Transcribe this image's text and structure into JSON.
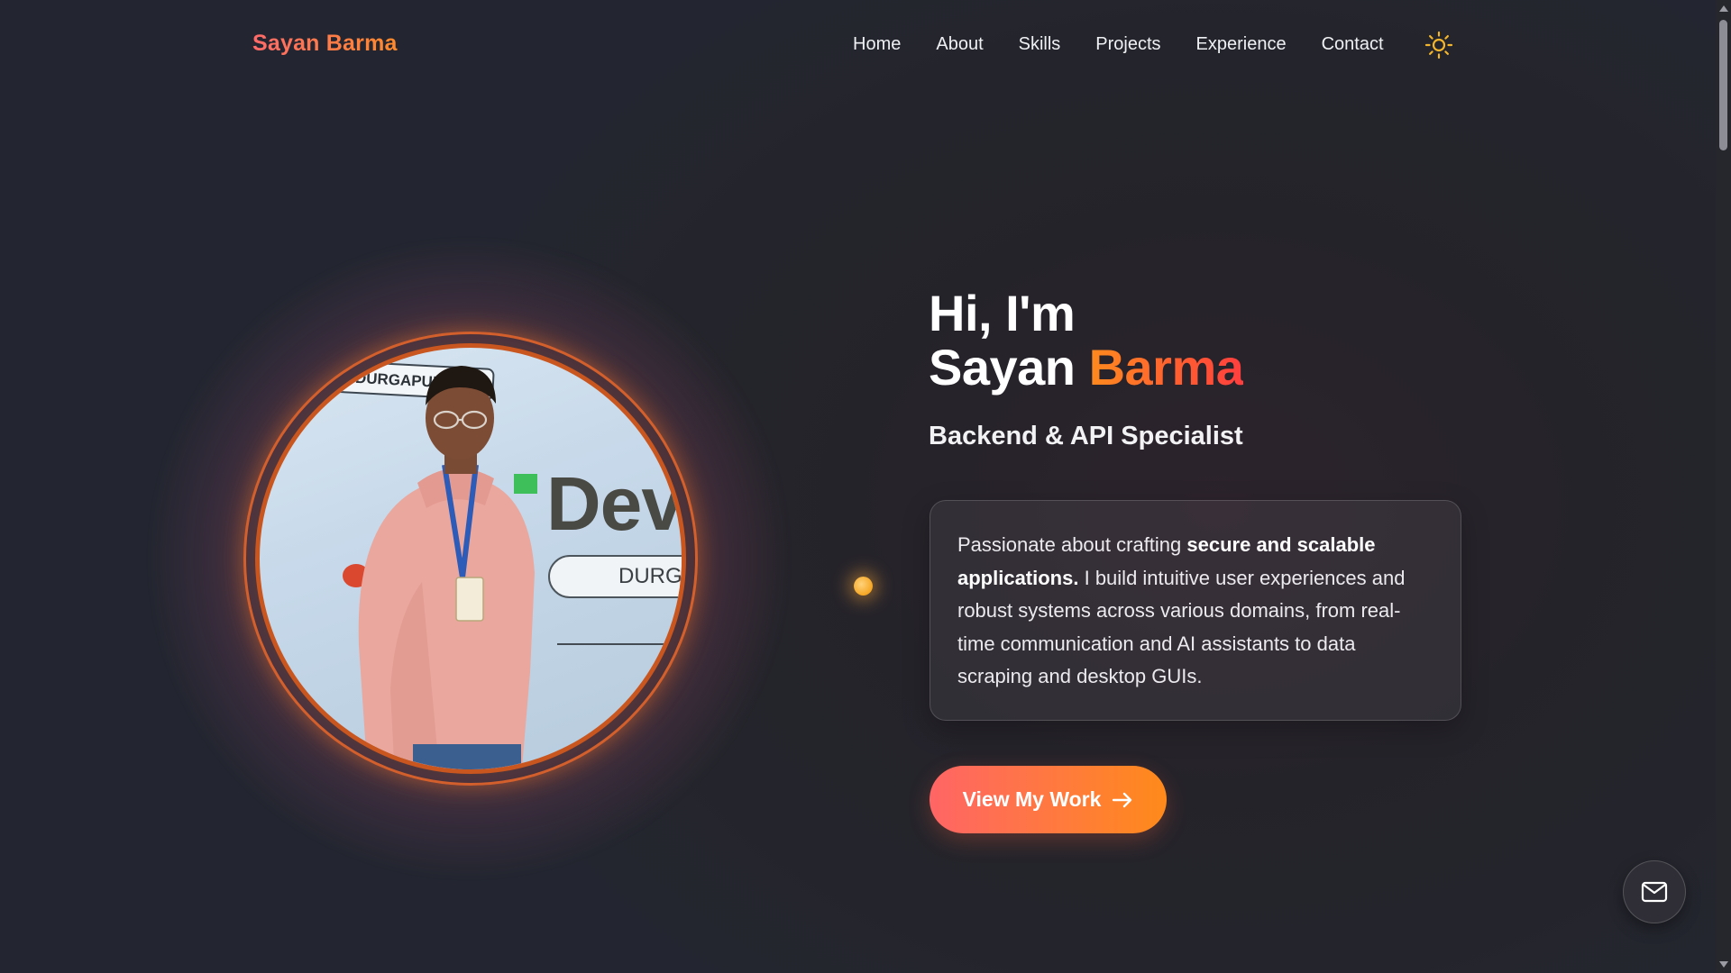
{
  "brand": {
    "name": "Sayan Barma"
  },
  "nav": {
    "items": [
      {
        "label": "Home"
      },
      {
        "label": "About"
      },
      {
        "label": "Skills"
      },
      {
        "label": "Projects"
      },
      {
        "label": "Experience"
      },
      {
        "label": "Contact"
      }
    ],
    "theme_toggle_icon": "sun-icon"
  },
  "hero": {
    "greeting": "Hi, I'm",
    "first_name": "Sayan",
    "last_name": "Barma",
    "role": "Backend & API Specialist",
    "intro": {
      "lead": "Passionate about crafting ",
      "emphasis": "secure and scalable applications.",
      "rest": " I build intuitive user experiences and robust systems across various domains, from real-time communication and AI assistants to data scraping and desktop GUIs."
    },
    "cta": {
      "label": "View My Work",
      "icon": "arrow-right-icon"
    },
    "photo_text": {
      "banner": "G DURGAPUR",
      "sign": "Dev",
      "pill": "DURG"
    }
  },
  "floating": {
    "mail_icon": "mail-icon"
  },
  "colors": {
    "accent_start": "#ff6565",
    "accent_end": "#ff8a1a",
    "background": "#24252c",
    "theme_icon": "#f5b52a"
  }
}
